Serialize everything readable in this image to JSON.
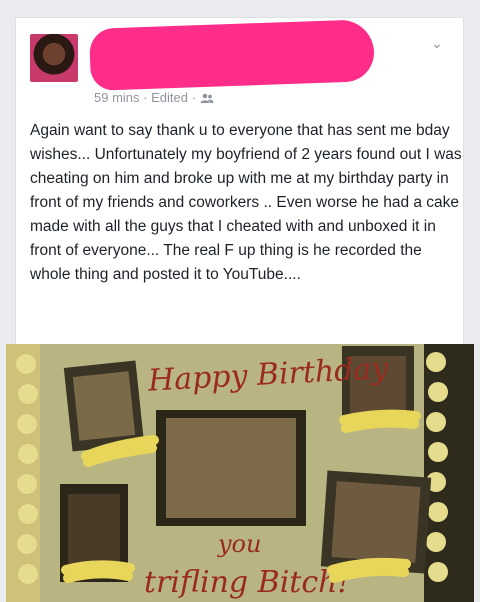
{
  "post": {
    "meta_time": "59 mins",
    "meta_edited": "Edited",
    "meta_sep": "·",
    "audience_icon": "friends-icon",
    "menu_icon": "chevron-down-icon",
    "text": "Again want to say thank u to everyone that has sent me bday wishes... Unfortunately my boyfriend of 2 years found out I was cheating on him and broke up with me at my birthday party in front of my friends and coworkers .. Even worse he had a cake made with all the guys that I cheated with and unboxed it in front of everyone... The real F up thing is he recorded the whole thing and posted it to YouTube...."
  },
  "cake": {
    "happy_birthday": "Happy Birthday",
    "bottom_line_1": "you",
    "bottom_line_2": "trifling Bitch!",
    "colors": {
      "frosting": "#b8b582",
      "icing_text": "#9a2a1e",
      "redaction": "#e8d65a"
    }
  }
}
